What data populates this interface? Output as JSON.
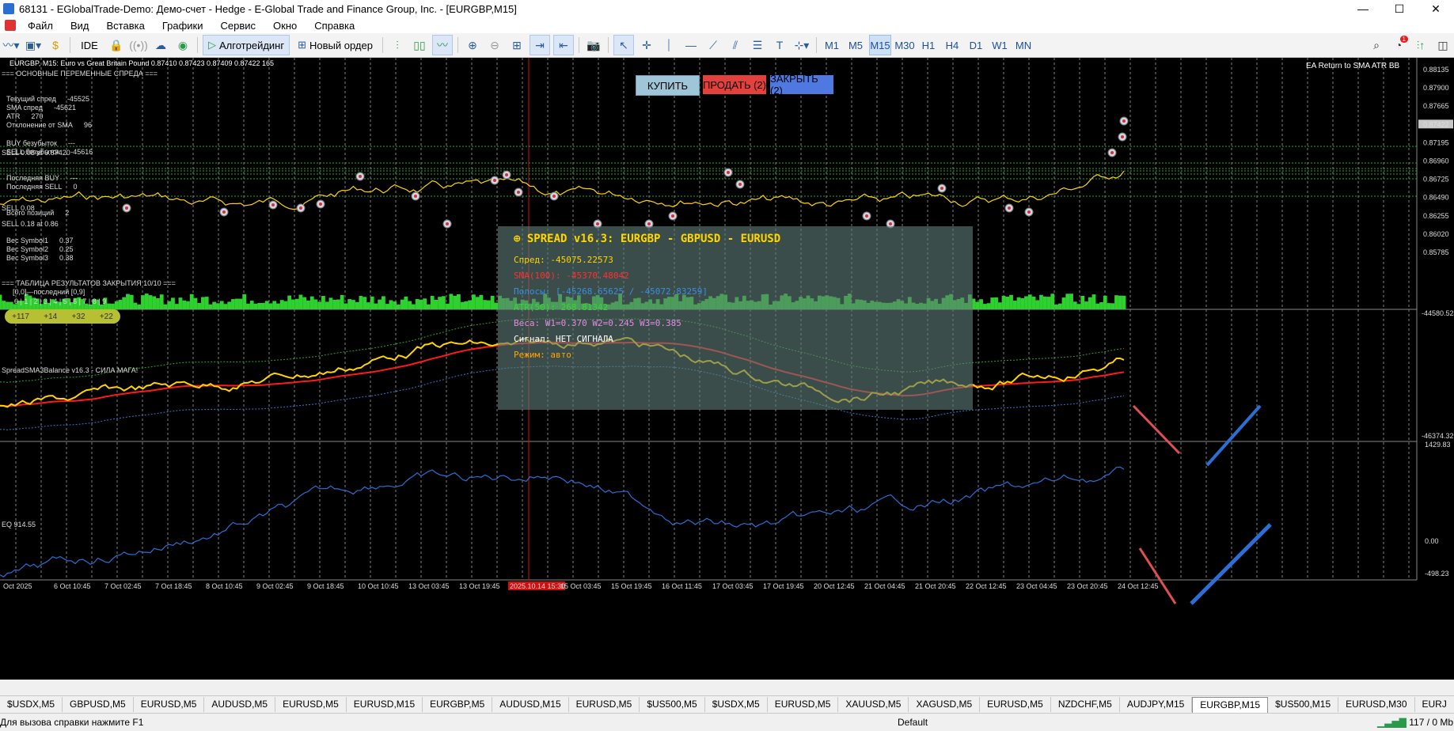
{
  "window": {
    "title": "68131 - EGlobalTrade-Demo: Демо-счет - Hedge - E-Global Trade and Finance Group, Inc. - [EURGBP,M15]",
    "minimize": "—",
    "maximize": "☐",
    "close": "✕"
  },
  "menu": [
    "Файл",
    "Вид",
    "Вставка",
    "Графики",
    "Сервис",
    "Окно",
    "Справка"
  ],
  "toolbar": {
    "ide": "IDE",
    "algo": "Алготрейдинг",
    "new_order": "Новый ордер",
    "timeframes": [
      "M1",
      "M5",
      "M15",
      "M30",
      "H1",
      "H4",
      "D1",
      "W1",
      "MN"
    ],
    "active_timeframe": "M15",
    "notifications": "1"
  },
  "chart": {
    "header": "EURGBP, M15: Euro vs Great Britain Pound  0.87410 0.87423 0.87409 0.87422  165",
    "ea_name": "EA Return to SMA ATR BB",
    "buy_label": "КУПИТЬ",
    "sell_label": "ПРОДАТЬ (2)",
    "close_label": "ЗАКРЫТЬ (2)",
    "price_axis": [
      "0.88135",
      "0.87900",
      "0.87665",
      "0.87422",
      "0.87195",
      "0.86960",
      "0.86725",
      "0.86490",
      "0.86255",
      "0.86020",
      "0.85785"
    ],
    "current_price": "0.87422",
    "indicator_title": "SpreadSMA3Balance v16.3 - СИЛА МАГА!",
    "indicator_axis_top": "-44580.524",
    "indicator_axis_bottom": "-46374.328",
    "eq_title": "EQ 914.55",
    "eq_axis": [
      "1429.83",
      "0.00",
      "-498.23"
    ],
    "time_axis": [
      "Oct 2025",
      "6 Oct 10:45",
      "7 Oct 02:45",
      "7 Oct 18:45",
      "8 Oct 10:45",
      "9 Oct 02:45",
      "9 Oct 18:45",
      "10 Oct 10:45",
      "13 Oct 03:45",
      "13 Oct 19:45",
      "2025.10.14 15:30",
      "15 Oct 03:45",
      "15 Oct 19:45",
      "16 Oct 11:45",
      "17 Oct 03:45",
      "17 Oct 19:45",
      "20 Oct 12:45",
      "21 Oct 04:45",
      "21 Oct 20:45",
      "22 Oct 12:45",
      "23 Oct 04:45",
      "23 Oct 20:45",
      "24 Oct 12:45"
    ],
    "highlight_time": "2025.10.14 15:30"
  },
  "left_panel": {
    "title1": "=== ОСНОВНЫЕ ПЕРЕМЕННЫЕ СПРЕДА ===",
    "rows": [
      {
        "label": "Текущий спред",
        "value": "-45525"
      },
      {
        "label": "SMA спред",
        "value": "-45621"
      },
      {
        "label": "ATR",
        "value": "270"
      },
      {
        "label": "Отклонение от SMA",
        "value": "96"
      },
      {
        "label": "BUY безубыток",
        "value": "---"
      },
      {
        "label": "SELL безубыток",
        "value": "-45616"
      },
      {
        "label": "Последняя BUY",
        "value": "---"
      },
      {
        "label": "Последняя SELL",
        "value": "0"
      },
      {
        "label": "Всего позиций",
        "value": "2"
      },
      {
        "label": "Вес Symbol1",
        "value": "0.37"
      },
      {
        "label": "Вес Symbol2",
        "value": "0.25"
      },
      {
        "label": "Вес Symbol3",
        "value": "0.38"
      }
    ],
    "sell_lines": [
      "SELL 0.08 at 0.87420",
      "SELL 0.08",
      "SELL 0.18 at 0.86"
    ],
    "title2": "=== ТАБЛИЦА РЕЗУЛЬТАТОВ ЗАКРЫТИЯ 10/10 ===",
    "results_hdr": "[0,0]—последний [0,9]",
    "results_cols": "0 | 1 | 2 | 3 | 4 | 5 | 6 | 7 | 8 | 9",
    "results": [
      "+117",
      "+14",
      "+32",
      "+22"
    ]
  },
  "spread_panel": {
    "title": "SPREAD v16.3: EURGBP - GBPUSD - EURUSD",
    "spread": "Спред: -45075.22573",
    "sma": "SMA(100): -45370.48042",
    "bands": "Полосы: [-45268.65625 / -45072.83259]",
    "atr": "ATR(50): 268.81342",
    "weights": "Веса: W1=0.370 W2=0.245 W3=0.385",
    "signal": "Сигнал: НЕТ СИГНАЛА",
    "mode": "Режим: авто"
  },
  "colors": {
    "price": "#ffd400",
    "sma": "#ff1a1a",
    "band_up": "#2ea32e",
    "band_down": "#2a7dd1",
    "volume": "#2ed12e",
    "eq": "#2a6fd6",
    "grid": "#7f7f7f"
  },
  "tabs": [
    "$USDX,M5",
    "GBPUSD,M5",
    "EURUSD,M5",
    "AUDUSD,M5",
    "EURUSD,M5",
    "EURUSD,M15",
    "EURGBP,M5",
    "AUDUSD,M15",
    "EURUSD,M5",
    "$US500,M5",
    "$USDX,M5",
    "EURUSD,M5",
    "XAUUSD,M5",
    "XAGUSD,M5",
    "EURUSD,M5",
    "NZDCHF,M5",
    "AUDJPY,M15",
    "EURGBP,M15",
    "$US500,M15",
    "EURUSD,M30",
    "EURJ"
  ],
  "active_tab": "EURGBP,M15",
  "status": {
    "help": "Для вызова справки нажмите F1",
    "profile": "Default",
    "traffic": "117 / 0 Mb"
  }
}
